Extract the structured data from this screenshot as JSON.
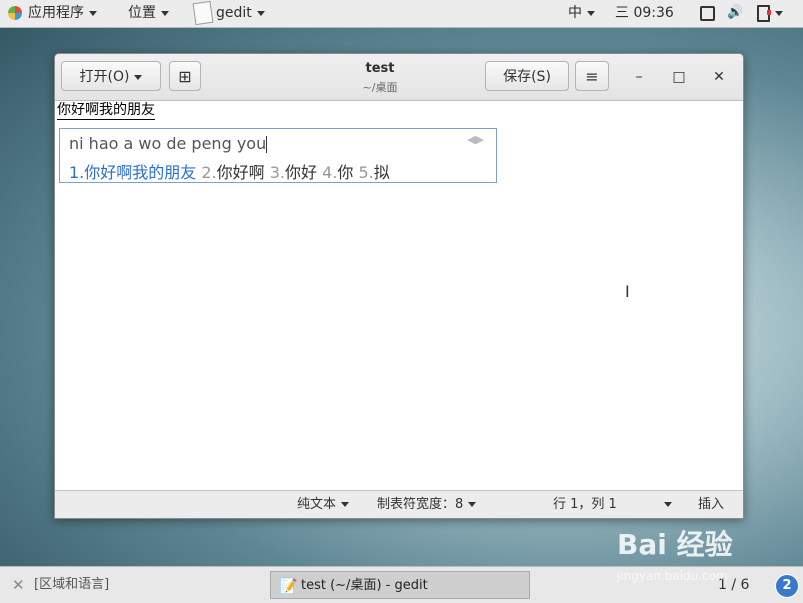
{
  "topbar": {
    "apps_label": "应用程序",
    "places_label": "位置",
    "app_label": "gedit",
    "ime_indicator": "中",
    "clock": "三 09:36"
  },
  "window": {
    "open_label": "打开(O)",
    "save_label": "保存(S)",
    "title": "test",
    "subtitle": "~/桌面",
    "minimize": "–",
    "maximize": "□",
    "close": "✕"
  },
  "editor": {
    "preedit_text": "你好啊我的朋友"
  },
  "ime": {
    "pinyin": "ni hao a wo de peng you",
    "candidates": [
      {
        "num": "1.",
        "text": "你好啊我的朋友"
      },
      {
        "num": "2.",
        "text": "你好啊"
      },
      {
        "num": "3.",
        "text": "你好"
      },
      {
        "num": "4.",
        "text": "你"
      },
      {
        "num": "5.",
        "text": "拟"
      }
    ]
  },
  "statusbar": {
    "lang": "纯文本",
    "tab_width": "制表符宽度：8",
    "position": "行 1，列 1",
    "mode": "插入"
  },
  "taskbar": {
    "region_task": "[区域和语言]",
    "gedit_task": "test (~/桌面) - gedit",
    "workspace": "1 / 6",
    "workspace_badge": "2"
  },
  "watermark": {
    "text": "Bai 经验",
    "sub": "jingyan.baidu.com"
  }
}
